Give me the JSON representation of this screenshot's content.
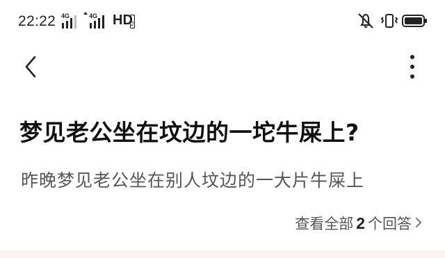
{
  "status_bar": {
    "time": "22:22",
    "network_label_1": "4G",
    "network_label_2": "4G",
    "hd_label": "HD",
    "hd_sub": "2",
    "icons": [
      "signal-icon",
      "signal-icon",
      "mute-icon",
      "vibrate-icon",
      "battery-icon"
    ]
  },
  "nav": {
    "back_icon": "chevron-left-icon",
    "more_icon": "more-vertical-icon"
  },
  "question": {
    "title": "梦见老公坐在坟边的一坨牛屎上?",
    "description": "昨晚梦见老公坐在别人坟边的一大片牛屎上"
  },
  "answers": {
    "prefix": "查看全部",
    "count": "2",
    "suffix": "个回答",
    "chevron_icon": "chevron-right-icon"
  },
  "colors": {
    "title": "#111111",
    "secondary_text": "#555555",
    "bottom_band": "#fbf2f2"
  }
}
